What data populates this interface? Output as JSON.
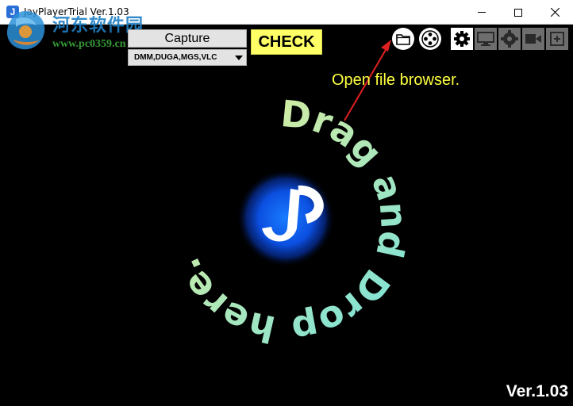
{
  "window": {
    "title": "JayPlayerTrial Ver.1.03",
    "app_icon_letter": "J",
    "minimize_label": "Minimize",
    "maximize_label": "Maximize",
    "close_label": "Close"
  },
  "watermark": {
    "site_name": "河东软件园",
    "url": "www.pc0359.cn"
  },
  "toolbar": {
    "capture_label": "Capture",
    "format_selected": "DMM,DUGA,MGS,VLC",
    "check_label": "CHECK",
    "icons": [
      "folder-icon",
      "gamepad-icon",
      "gear-icon",
      "monitor-icon",
      "display-settings-icon",
      "video-camera-icon",
      "add-window-icon"
    ]
  },
  "hint": {
    "text": "Open file browser."
  },
  "drop_area": {
    "text": "Drag and Drop here.",
    "logo_letter": "J"
  },
  "version_label": "Ver.1.03",
  "colors": {
    "background": "#000000",
    "check_button": "#ffff66",
    "hint_text": "#ffff40",
    "arrow": "#e02020",
    "logo_glow": "#1a6dff",
    "curve_text_start": "#f0f090",
    "curve_text_end": "#70e0e0"
  }
}
